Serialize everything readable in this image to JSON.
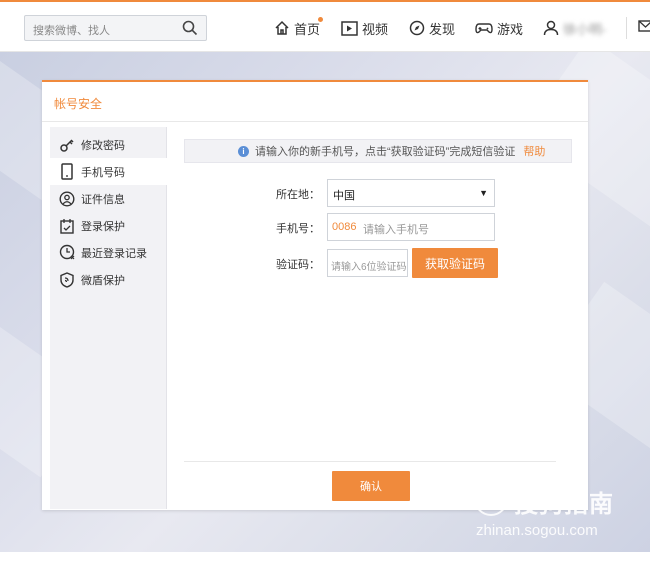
{
  "topbar": {
    "search_placeholder": "搜索微博、找人",
    "nav": [
      {
        "label": "首页",
        "icon": "home-icon"
      },
      {
        "label": "视频",
        "icon": "video-icon"
      },
      {
        "label": "发现",
        "icon": "compass-icon"
      },
      {
        "label": "游戏",
        "icon": "gamepad-icon"
      },
      {
        "label": "徐小明-",
        "icon": "user-icon"
      }
    ]
  },
  "panel": {
    "title": "帐号安全",
    "sidebar": [
      {
        "label": "修改密码",
        "icon": "key-icon"
      },
      {
        "label": "手机号码",
        "icon": "phone-icon",
        "active": true
      },
      {
        "label": "证件信息",
        "icon": "id-card-icon"
      },
      {
        "label": "登录保护",
        "icon": "calendar-check-icon"
      },
      {
        "label": "最近登录记录",
        "icon": "clock-icon"
      },
      {
        "label": "微盾保护",
        "icon": "shield-icon"
      }
    ],
    "notice": {
      "text": "请输入你的新手机号，点击“获取验证码”完成短信验证",
      "help": "帮助"
    },
    "form": {
      "region_label": "所在地：",
      "region_value": "中国",
      "phone_label": "手机号：",
      "country_code": "0086",
      "phone_placeholder": "请输入手机号",
      "code_label": "验证码：",
      "code_placeholder": "请输入6位验证码",
      "get_code_button": "获取验证码"
    },
    "confirm_button": "确认"
  },
  "watermark": {
    "cn": "搜狗指南",
    "en": "zhinan.sogou.com"
  },
  "colors": {
    "accent": "#f08a3c",
    "info": "#5b8fd6"
  }
}
